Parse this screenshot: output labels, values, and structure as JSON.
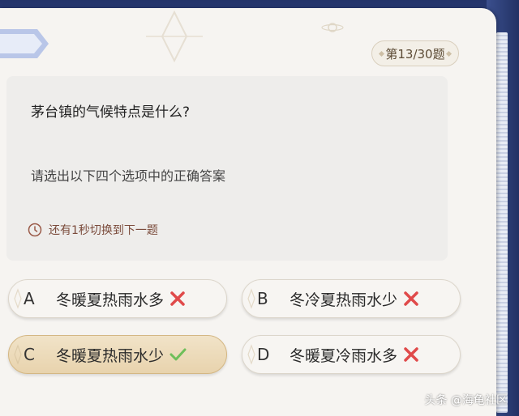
{
  "counter": {
    "label": "第13/30题"
  },
  "question": {
    "text": "茅台镇的气候特点是什么?",
    "instruction": "请选出以下四个选项中的正确答案",
    "timer_text": "还有1秒切换到下一题"
  },
  "options": [
    {
      "letter": "A",
      "text": "冬暖夏热雨水多",
      "result": "wrong",
      "selected": false
    },
    {
      "letter": "B",
      "text": "冬冷夏热雨水少",
      "result": "wrong",
      "selected": false
    },
    {
      "letter": "C",
      "text": "冬暖夏热雨水少",
      "result": "correct",
      "selected": true
    },
    {
      "letter": "D",
      "text": "冬暖夏冷雨水多",
      "result": "wrong",
      "selected": false
    }
  ],
  "watermark": {
    "text": "头条 @海龟社区"
  },
  "colors": {
    "card_bg": "#f6f4f1",
    "frame": "#2a3a6e",
    "wrong_mark": "#e04a4a",
    "correct_mark": "#6fbf5a",
    "selected_option": "#ecd9b6"
  }
}
